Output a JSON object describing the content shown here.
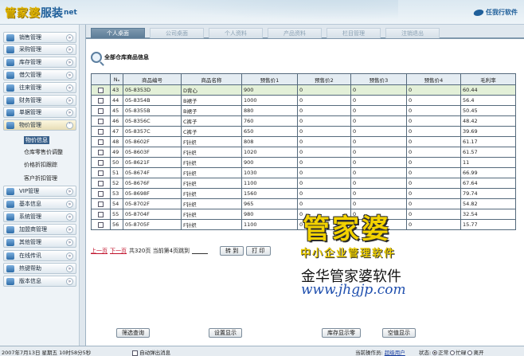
{
  "header": {
    "logo_part1": "管家婆",
    "logo_part2": "服装",
    "logo_part3": "net",
    "brand": "任我行软件"
  },
  "sidebar": {
    "items": [
      {
        "label": "销售管理",
        "icon": "cart-icon"
      },
      {
        "label": "采购管理",
        "icon": "purchase-icon"
      },
      {
        "label": "库存管理",
        "icon": "stock-icon"
      },
      {
        "label": "借欠管理",
        "icon": "loan-icon"
      },
      {
        "label": "往来管理",
        "icon": "exchange-icon"
      },
      {
        "label": "财务管理",
        "icon": "finance-icon"
      },
      {
        "label": "单据管理",
        "icon": "document-icon"
      },
      {
        "label": "物价管理",
        "icon": "price-icon"
      }
    ],
    "sub_items": [
      "物价信息",
      "仓库零售价调整",
      "价格折扣跟踪",
      "客户折扣管理"
    ],
    "items2": [
      {
        "label": "VIP管理",
        "icon": "vip-icon"
      },
      {
        "label": "基本信息",
        "icon": "info-icon"
      },
      {
        "label": "系统管理",
        "icon": "system-icon"
      },
      {
        "label": "加盟商管理",
        "icon": "franchise-icon"
      },
      {
        "label": "其他管理",
        "icon": "other-icon"
      },
      {
        "label": "在线传讯",
        "icon": "message-icon"
      },
      {
        "label": "热键帮助",
        "icon": "help-icon"
      },
      {
        "label": "版本信息",
        "icon": "version-icon"
      }
    ]
  },
  "tabs": [
    "个人桌面",
    "公司桌面",
    "个人资料",
    "产品资料",
    "栏目管理",
    "注销退出"
  ],
  "section_title": "全部仓库商品信息",
  "table": {
    "headers": [
      "Nₒ",
      "商品编号",
      "商品名称",
      "预售价1",
      "预售价2",
      "预售价3",
      "预售价4",
      "毛利率"
    ],
    "rows": [
      [
        "43",
        "05-8353D",
        "D背心",
        "900",
        "0",
        "0",
        "0",
        "60.44"
      ],
      [
        "44",
        "05-8354B",
        "B裙子",
        "1000",
        "0",
        "0",
        "0",
        "56.4"
      ],
      [
        "45",
        "05-8355B",
        "B裙子",
        "880",
        "0",
        "0",
        "0",
        "50.45"
      ],
      [
        "46",
        "05-8356C",
        "C裤子",
        "760",
        "0",
        "0",
        "0",
        "48.42"
      ],
      [
        "47",
        "05-8357C",
        "C裤子",
        "650",
        "0",
        "0",
        "0",
        "39.69"
      ],
      [
        "48",
        "05-8602F",
        "F针织",
        "808",
        "0",
        "0",
        "0",
        "61.17"
      ],
      [
        "49",
        "05-8603F",
        "F针织",
        "1020",
        "0",
        "0",
        "0",
        "61.57"
      ],
      [
        "50",
        "05-8621F",
        "F针织",
        "900",
        "0",
        "0",
        "0",
        "11"
      ],
      [
        "51",
        "05-8674F",
        "F针织",
        "1030",
        "0",
        "0",
        "0",
        "66.99"
      ],
      [
        "52",
        "05-8676F",
        "F针织",
        "1100",
        "0",
        "0",
        "0",
        "67.64"
      ],
      [
        "53",
        "05-8698F",
        "F针织",
        "1560",
        "0",
        "0",
        "0",
        "79.74"
      ],
      [
        "54",
        "05-8702F",
        "F针织",
        "965",
        "0",
        "0",
        "0",
        "54.82"
      ],
      [
        "55",
        "05-8704F",
        "F针织",
        "980",
        "0",
        "0",
        "0",
        "32.54"
      ],
      [
        "56",
        "05-8705F",
        "F针织",
        "1100",
        "0",
        "0",
        "0",
        "15.77"
      ]
    ]
  },
  "pager": {
    "prev": "上一页",
    "next": "下一页",
    "info": "共320页 当前第4页跳到",
    "goto": "转 到",
    "print": "打 印"
  },
  "buttons": {
    "filter": "筛选查询",
    "settings": "设置显示",
    "stock": "库存显示零",
    "empty": "空值显示"
  },
  "watermark": {
    "big": "管家婆",
    "sub": "中小企业管理软件",
    "cn": "金华管家婆软件",
    "url": "www.jhgjp.com"
  },
  "status": {
    "datetime": "2007年7月13日 星期五 10时58分5秒",
    "auto_popup": "自动弹出消息",
    "operator_label": "当前操作员:",
    "operator": "超级用户",
    "state_label": "状态:",
    "states": [
      "正常",
      "忙碌",
      "离开"
    ]
  }
}
